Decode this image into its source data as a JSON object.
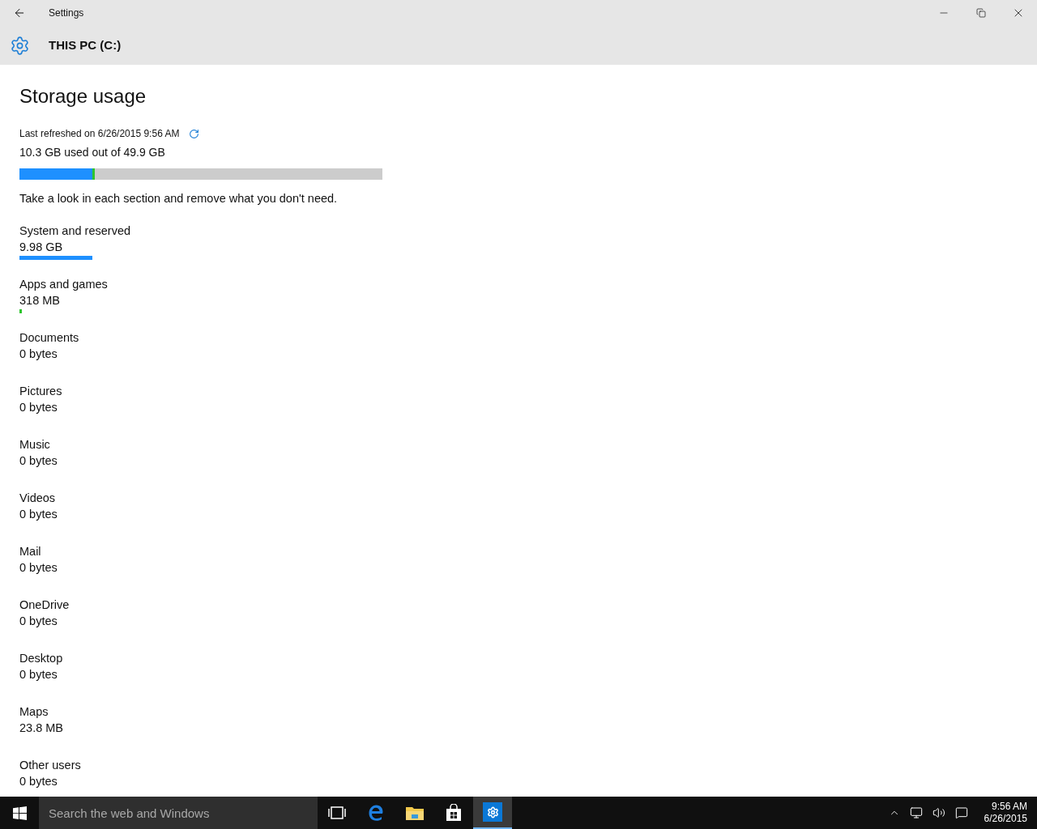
{
  "window": {
    "title": "Settings"
  },
  "header": {
    "title": "THIS PC (C:)"
  },
  "page": {
    "title": "Storage usage",
    "refreshed": "Last refreshed on 6/26/2015 9:56 AM",
    "usage": "10.3 GB used out of 49.9 GB",
    "usage_bar": [
      {
        "level": 0.2,
        "color": "#1e90ff"
      },
      {
        "level": 0.006,
        "color": "#2ec52e"
      }
    ],
    "hint": "Take a look in each section and remove what you don't need."
  },
  "categories": [
    {
      "name": "System and reserved",
      "size": "9.98 GB",
      "level": 0.2,
      "color": "#1e90ff"
    },
    {
      "name": "Apps and games",
      "size": "318 MB",
      "level": 0.006,
      "color": "#2ec52e"
    },
    {
      "name": "Documents",
      "size": "0 bytes"
    },
    {
      "name": "Pictures",
      "size": "0 bytes"
    },
    {
      "name": "Music",
      "size": "0 bytes"
    },
    {
      "name": "Videos",
      "size": "0 bytes"
    },
    {
      "name": "Mail",
      "size": "0 bytes"
    },
    {
      "name": "OneDrive",
      "size": "0 bytes"
    },
    {
      "name": "Desktop",
      "size": "0 bytes"
    },
    {
      "name": "Maps",
      "size": "23.8 MB"
    },
    {
      "name": "Other users",
      "size": "0 bytes"
    }
  ],
  "taskbar": {
    "search_placeholder": "Search the web and Windows",
    "apps": [
      {
        "kind": "taskview",
        "selected": false
      },
      {
        "kind": "browser",
        "selected": false
      },
      {
        "kind": "folder",
        "selected": false
      },
      {
        "kind": "store",
        "selected": false
      },
      {
        "kind": "settings",
        "selected": true
      }
    ],
    "time": "9:56 AM",
    "date": "6/26/2015"
  }
}
